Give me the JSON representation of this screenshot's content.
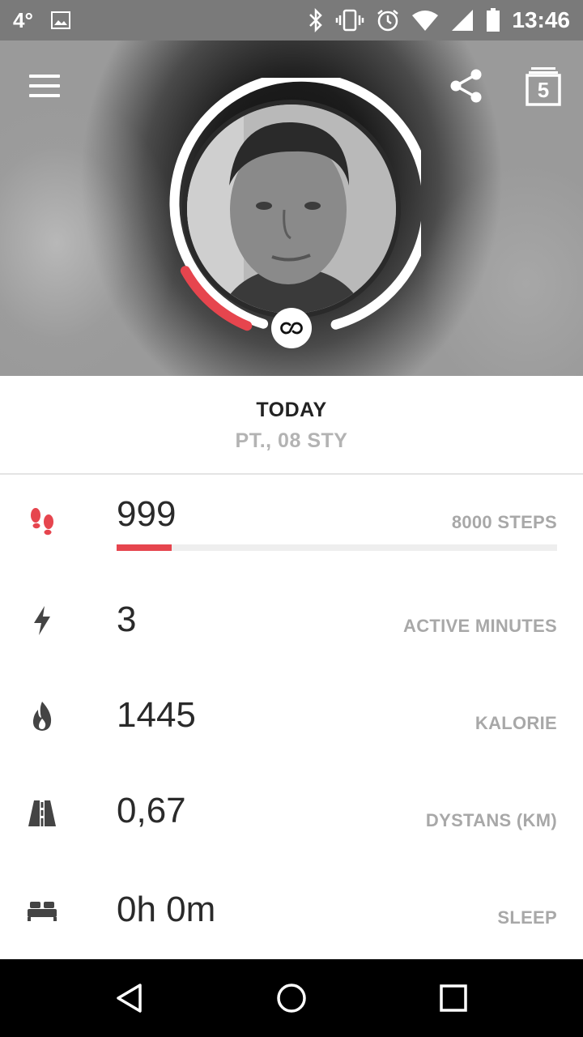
{
  "status_bar": {
    "temperature": "4°",
    "time": "13:46",
    "icons": [
      "image-icon",
      "bluetooth-icon",
      "vibrate-icon",
      "alarm-icon",
      "wifi-icon",
      "signal-icon",
      "battery-icon"
    ]
  },
  "header": {
    "menu_icon": "menu-icon",
    "share_icon": "share-icon",
    "calendar_day": "5",
    "progress_ring_fraction": 0.125,
    "accent_color": "#e6454e"
  },
  "date": {
    "title": "TODAY",
    "subtitle": "PT., 08 STY"
  },
  "metrics": {
    "steps": {
      "value": "999",
      "label": "8000 STEPS",
      "icon": "footsteps-icon",
      "progress_fraction": 0.125
    },
    "active_minutes": {
      "value": "3",
      "label": "ACTIVE MINUTES",
      "icon": "lightning-icon"
    },
    "calories": {
      "value": "1445",
      "label": "KALORIE",
      "icon": "flame-icon"
    },
    "distance": {
      "value": "0,67",
      "label": "DYSTANS (KM)",
      "icon": "road-icon"
    },
    "sleep": {
      "value": "0h 0m",
      "label": "SLEEP",
      "icon": "bed-icon"
    }
  },
  "nav_bar": {
    "buttons": [
      "back-icon",
      "home-icon",
      "recents-icon"
    ]
  }
}
